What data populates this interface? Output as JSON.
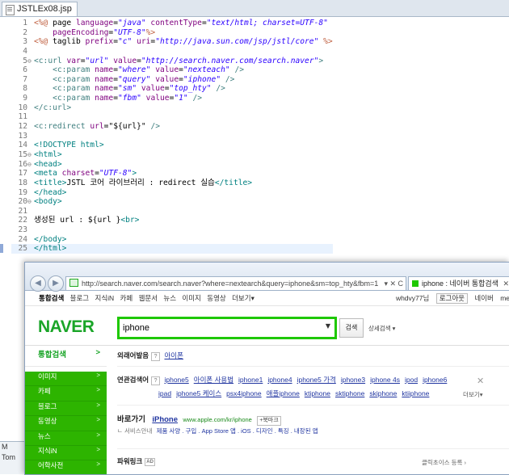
{
  "editor": {
    "tab_title": "JSTLEx08.jsp",
    "lines": [
      {
        "n": "1",
        "fold": "",
        "parts": [
          [
            "dr",
            "<%@"
          ],
          [
            "pl",
            " page "
          ],
          [
            "at",
            "language"
          ],
          [
            "pl",
            "="
          ],
          [
            "sv",
            "\"java\""
          ],
          [
            "pl",
            " "
          ],
          [
            "at",
            "contentType"
          ],
          [
            "pl",
            "="
          ],
          [
            "sv",
            "\"text/html; charset=UTF-8\""
          ]
        ]
      },
      {
        "n": "2",
        "fold": "",
        "parts": [
          [
            "pl",
            "    "
          ],
          [
            "at",
            "pageEncoding"
          ],
          [
            "pl",
            "="
          ],
          [
            "sv",
            "\"UTF-8\""
          ],
          [
            "dr",
            "%>"
          ]
        ]
      },
      {
        "n": "3",
        "fold": "",
        "parts": [
          [
            "dr",
            "<%@"
          ],
          [
            "pl",
            " taglib "
          ],
          [
            "at",
            "prefix"
          ],
          [
            "pl",
            "="
          ],
          [
            "sv",
            "\"c\""
          ],
          [
            "pl",
            " "
          ],
          [
            "at",
            "uri"
          ],
          [
            "pl",
            "="
          ],
          [
            "sv",
            "\"http://java.sun.com/jsp/jstl/core\""
          ],
          [
            "pl",
            " "
          ],
          [
            "dr",
            "%>"
          ]
        ]
      },
      {
        "n": "4",
        "fold": "",
        "parts": []
      },
      {
        "n": "5",
        "fold": "⊖",
        "parts": [
          [
            "k",
            "<c:url"
          ],
          [
            "pl",
            " "
          ],
          [
            "at",
            "var"
          ],
          [
            "pl",
            "="
          ],
          [
            "sv",
            "\"url\""
          ],
          [
            "pl",
            " "
          ],
          [
            "at",
            "value"
          ],
          [
            "pl",
            "="
          ],
          [
            "sv",
            "\"http://search.naver.com/search.naver\""
          ],
          [
            "k",
            ">"
          ]
        ]
      },
      {
        "n": "6",
        "fold": "",
        "parts": [
          [
            "pl",
            "    "
          ],
          [
            "k",
            "<c:param"
          ],
          [
            "pl",
            " "
          ],
          [
            "at",
            "name"
          ],
          [
            "pl",
            "="
          ],
          [
            "sv",
            "\"where\""
          ],
          [
            "pl",
            " "
          ],
          [
            "at",
            "value"
          ],
          [
            "pl",
            "="
          ],
          [
            "sv",
            "\"nexteach\""
          ],
          [
            "pl",
            " "
          ],
          [
            "k",
            "/>"
          ]
        ]
      },
      {
        "n": "7",
        "fold": "",
        "parts": [
          [
            "pl",
            "    "
          ],
          [
            "k",
            "<c:param"
          ],
          [
            "pl",
            " "
          ],
          [
            "at",
            "name"
          ],
          [
            "pl",
            "="
          ],
          [
            "sv",
            "\"query\""
          ],
          [
            "pl",
            " "
          ],
          [
            "at",
            "value"
          ],
          [
            "pl",
            "="
          ],
          [
            "sv",
            "\"iphone\""
          ],
          [
            "pl",
            " "
          ],
          [
            "k",
            "/>"
          ]
        ]
      },
      {
        "n": "8",
        "fold": "",
        "parts": [
          [
            "pl",
            "    "
          ],
          [
            "k",
            "<c:param"
          ],
          [
            "pl",
            " "
          ],
          [
            "at",
            "name"
          ],
          [
            "pl",
            "="
          ],
          [
            "sv",
            "\"sm\""
          ],
          [
            "pl",
            " "
          ],
          [
            "at",
            "value"
          ],
          [
            "pl",
            "="
          ],
          [
            "sv",
            "\"top_hty\""
          ],
          [
            "pl",
            " "
          ],
          [
            "k",
            "/>"
          ]
        ]
      },
      {
        "n": "9",
        "fold": "",
        "parts": [
          [
            "pl",
            "    "
          ],
          [
            "k",
            "<c:param"
          ],
          [
            "pl",
            " "
          ],
          [
            "at",
            "name"
          ],
          [
            "pl",
            "="
          ],
          [
            "sv",
            "\"fbm\""
          ],
          [
            "pl",
            " "
          ],
          [
            "at",
            "value"
          ],
          [
            "pl",
            "="
          ],
          [
            "sv",
            "\"1\""
          ],
          [
            "pl",
            " "
          ],
          [
            "k",
            "/>"
          ]
        ]
      },
      {
        "n": "10",
        "fold": "",
        "parts": [
          [
            "k",
            "</c:url>"
          ]
        ]
      },
      {
        "n": "11",
        "fold": "",
        "parts": []
      },
      {
        "n": "12",
        "fold": "",
        "parts": [
          [
            "k",
            "<c:redirect"
          ],
          [
            "pl",
            " "
          ],
          [
            "at",
            "url"
          ],
          [
            "pl",
            "="
          ],
          [
            "pl",
            "\"${url}\""
          ],
          [
            "pl",
            " "
          ],
          [
            "k",
            "/>"
          ]
        ]
      },
      {
        "n": "13",
        "fold": "",
        "parts": []
      },
      {
        "n": "14",
        "fold": "",
        "parts": [
          [
            "bt",
            "<!DOCTYPE html>"
          ]
        ]
      },
      {
        "n": "15",
        "fold": "⊖",
        "parts": [
          [
            "bt",
            "<html>"
          ]
        ]
      },
      {
        "n": "16",
        "fold": "⊖",
        "parts": [
          [
            "bt",
            "<head>"
          ]
        ]
      },
      {
        "n": "17",
        "fold": "",
        "parts": [
          [
            "bt",
            "<meta"
          ],
          [
            "pl",
            " "
          ],
          [
            "at",
            "charset"
          ],
          [
            "pl",
            "="
          ],
          [
            "sv",
            "\"UTF-8\""
          ],
          [
            "bt",
            ">"
          ]
        ]
      },
      {
        "n": "18",
        "fold": "",
        "parts": [
          [
            "bt",
            "<title>"
          ],
          [
            "pl",
            "JSTL 코어 라이브러리 : redirect 실습"
          ],
          [
            "bt",
            "</title>"
          ]
        ]
      },
      {
        "n": "19",
        "fold": "",
        "parts": [
          [
            "bt",
            "</head>"
          ]
        ]
      },
      {
        "n": "20",
        "fold": "⊖",
        "parts": [
          [
            "bt",
            "<body>"
          ]
        ]
      },
      {
        "n": "21",
        "fold": "",
        "parts": []
      },
      {
        "n": "22",
        "fold": "",
        "parts": [
          [
            "pl",
            "생성된 url : ${url }"
          ],
          [
            "bt",
            "<br>"
          ]
        ]
      },
      {
        "n": "23",
        "fold": "",
        "parts": []
      },
      {
        "n": "24",
        "fold": "",
        "parts": [
          [
            "bt",
            "</body>"
          ]
        ]
      },
      {
        "n": "25",
        "fold": "",
        "parts": [
          [
            "bt",
            "</html>"
          ]
        ]
      }
    ],
    "current_line": "25"
  },
  "leftpane": {
    "items": [
      "M",
      "Tom"
    ]
  },
  "browser": {
    "back_glyph": "◀",
    "forward_glyph": "▶",
    "address": "http://search.naver.com/search.naver?where=nextearch&query=iphone&sm=top_hty&fbm=1",
    "address_controls": "▾ ✕ C",
    "tab_title": "iphone : 네이버 통합검색",
    "tab_close": "✕"
  },
  "naver": {
    "topmenu": [
      "통합검색",
      "블로그",
      "지식iN",
      "카페",
      "웹문서",
      "뉴스",
      "이미지",
      "동영상",
      "더보기▾"
    ],
    "user": "whdvy77님",
    "logout": "로그아웃",
    "right_links": [
      "네이버",
      "me"
    ],
    "logo": "NAVER",
    "query": "iphone",
    "dropdown_glyph": "▼",
    "search_button": "검색",
    "advanced": "상세검색 ▾",
    "lnav_head": "통합검색",
    "lnav_arrow": ">",
    "lnav_items": [
      "이미지",
      "카페",
      "블로그",
      "동영상",
      "뉴스",
      "지식iN",
      "어학사전"
    ],
    "foreign_label": "외래어발음",
    "foreign_value": "아이폰",
    "related_label": "연관검색어",
    "related_row1": [
      "iphone5",
      "아이폰 사용법",
      "iphone1",
      "iphone4",
      "iphone5 가격",
      "iphone3",
      "iphone 4s",
      "ipod",
      "iphone6"
    ],
    "related_row2": [
      "ipad",
      "iphone5 케이스",
      "psx4iphone",
      "애플iphone",
      "ktiphone",
      "sktiphone",
      "skiphone",
      "ktiiphone"
    ],
    "close_glyph": "✕",
    "more": "더보기▾",
    "shortcut_label": "바로가기",
    "shortcut_name": "iPhone",
    "shortcut_url": "www.apple.com/kr/iphone",
    "bookmark": "+북마크",
    "service_info": "ㄴ 서비스안내",
    "service_links": "제품 사양 . 구입 . App Store 앱 . iOS . 디자인 . 특징 . 내장된 앱",
    "powerlink": "파워링크",
    "ad_tag": "AD",
    "ad_register": "클릭초이스 등록 ›"
  }
}
